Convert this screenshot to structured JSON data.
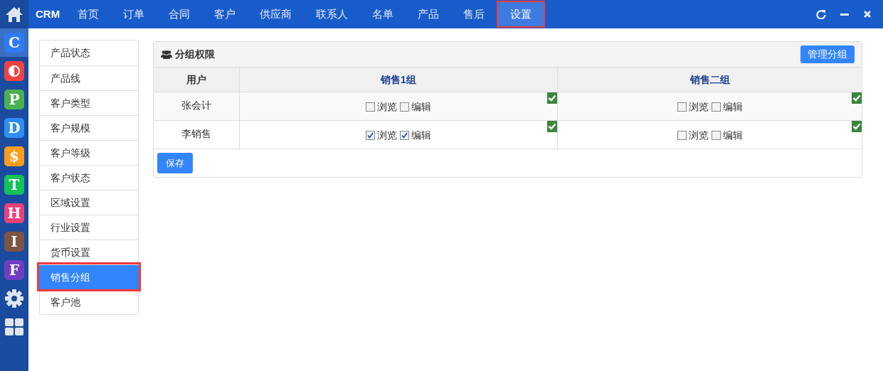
{
  "rail": {
    "items": [
      {
        "kind": "letter",
        "text": "C",
        "color": "#2f7af5",
        "selected": true
      },
      {
        "kind": "half-circle",
        "color": "#ef4343",
        "selected": false
      },
      {
        "kind": "letter",
        "text": "P",
        "color": "#4caf50",
        "selected": false
      },
      {
        "kind": "letter",
        "text": "D",
        "color": "#2d8ff0",
        "selected": false
      },
      {
        "kind": "letter",
        "text": "$",
        "color": "#ff9d18",
        "selected": false
      },
      {
        "kind": "letter",
        "text": "T",
        "color": "#14c25a",
        "selected": false
      },
      {
        "kind": "letter",
        "text": "H",
        "color": "#ec407a",
        "selected": false
      },
      {
        "kind": "letter",
        "text": "I",
        "color": "#7b5443",
        "selected": false
      },
      {
        "kind": "letter",
        "text": "F",
        "color": "#6d3fc0",
        "selected": false
      },
      {
        "kind": "gear",
        "selected": false
      },
      {
        "kind": "grid",
        "selected": false
      }
    ]
  },
  "topbar": {
    "brand": "CRM",
    "nav": [
      {
        "label": "首页",
        "selected": false
      },
      {
        "label": "订单",
        "selected": false
      },
      {
        "label": "合同",
        "selected": false
      },
      {
        "label": "客户",
        "selected": false
      },
      {
        "label": "供应商",
        "selected": false
      },
      {
        "label": "联系人",
        "selected": false
      },
      {
        "label": "名单",
        "selected": false
      },
      {
        "label": "产品",
        "selected": false
      },
      {
        "label": "售后",
        "selected": false
      },
      {
        "label": "设置",
        "selected": true
      }
    ]
  },
  "sidebar": {
    "items": [
      {
        "label": "产品状态",
        "selected": false
      },
      {
        "label": "产品线",
        "selected": false
      },
      {
        "label": "客户类型",
        "selected": false
      },
      {
        "label": "客户规模",
        "selected": false
      },
      {
        "label": "客户等级",
        "selected": false
      },
      {
        "label": "客户状态",
        "selected": false
      },
      {
        "label": "区域设置",
        "selected": false
      },
      {
        "label": "行业设置",
        "selected": false
      },
      {
        "label": "货币设置",
        "selected": false
      },
      {
        "label": "销售分组",
        "selected": true
      },
      {
        "label": "客户池",
        "selected": false
      }
    ]
  },
  "panel": {
    "title": "分组权限",
    "manage_button": "管理分组",
    "table": {
      "columns": [
        "用户",
        "销售1组",
        "销售二组"
      ],
      "rows": [
        {
          "cells": [
            {
              "kind": "user",
              "text": "张会计"
            },
            {
              "kind": "permissions",
              "permissions": [
                {
                  "label": "浏览",
                  "checked": false
                },
                {
                  "label": "编辑",
                  "checked": false
                }
              ]
            },
            {
              "kind": "permissions",
              "permissions": [
                {
                  "label": "浏览",
                  "checked": false
                },
                {
                  "label": "编辑",
                  "checked": false
                }
              ]
            }
          ]
        },
        {
          "cells": [
            {
              "kind": "user",
              "text": "李销售"
            },
            {
              "kind": "permissions",
              "permissions": [
                {
                  "label": "浏览",
                  "checked": true
                },
                {
                  "label": "编辑",
                  "checked": true
                }
              ]
            },
            {
              "kind": "permissions",
              "permissions": [
                {
                  "label": "浏览",
                  "checked": false
                },
                {
                  "label": "编辑",
                  "checked": false
                }
              ]
            }
          ]
        }
      ]
    },
    "save_button": "保存"
  }
}
